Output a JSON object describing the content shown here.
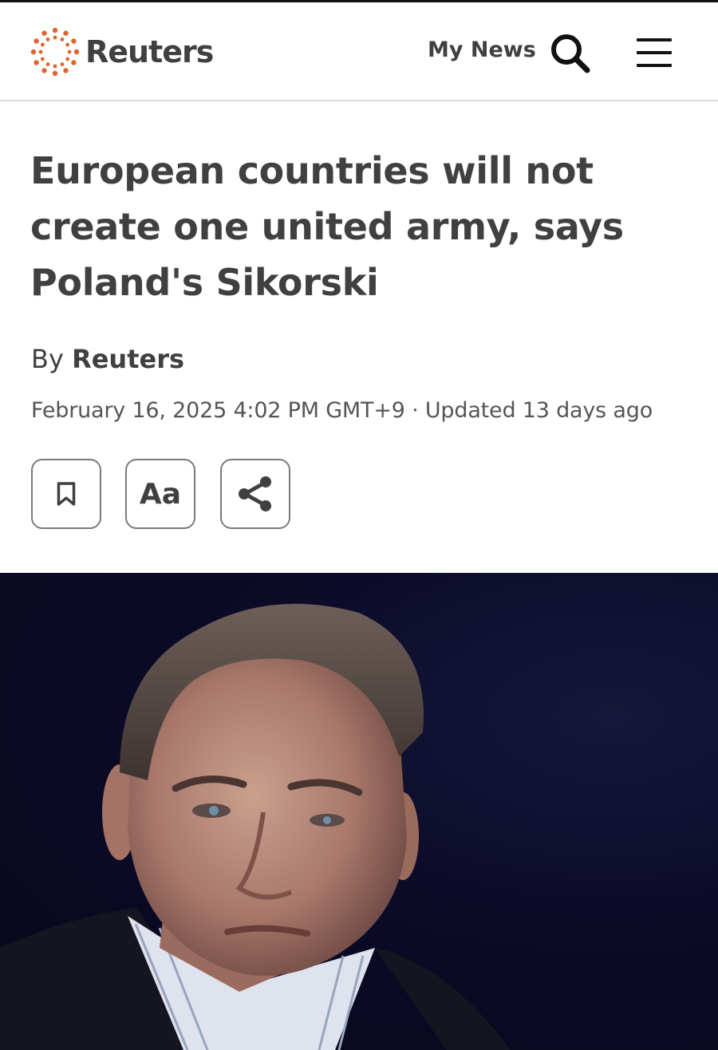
{
  "header": {
    "logo_text": "Reuters",
    "my_news_label": "My News",
    "search_icon": "search-icon",
    "menu_icon": "hamburger-menu-icon"
  },
  "article": {
    "headline": "European countries will not create one united army, says Poland's Sikorski",
    "byline_prefix": "By",
    "byline_author": "Reuters",
    "dateline": "February 16, 2025 4:02 PM GMT+9 · Updated 13 days ago"
  },
  "tools": {
    "bookmark_icon": "bookmark-icon",
    "text_size_label": "Aa",
    "share_icon": "share-icon"
  },
  "colors": {
    "text": "#404040",
    "logo_accent": "#e0642b",
    "photo_background": "#0b0b28"
  }
}
